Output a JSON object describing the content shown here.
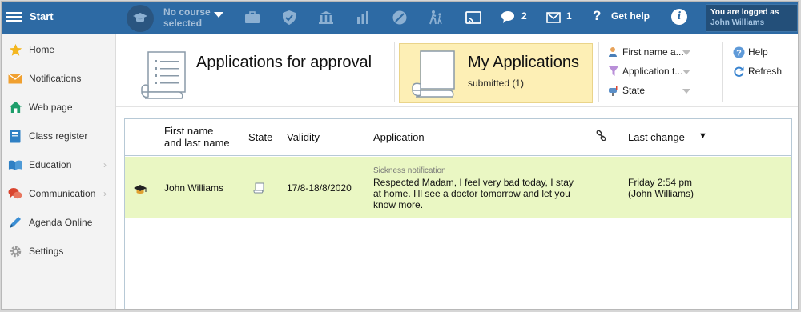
{
  "topbar": {
    "start_label": "Start",
    "course_line1": "No course",
    "course_line2": "selected",
    "messages_count": "2",
    "mail_count": "1",
    "help_label": "Get help",
    "login_line1": "You are logged as",
    "login_user": "John Williams",
    "colors": {
      "bar": "#2d6aa4",
      "login_bg": "#234f79"
    }
  },
  "sidebar": {
    "items": [
      {
        "label": "Home",
        "icon": "star-icon",
        "has_submenu": false
      },
      {
        "label": "Notifications",
        "icon": "envelope-icon",
        "has_submenu": false
      },
      {
        "label": "Web page",
        "icon": "house-icon",
        "has_submenu": false
      },
      {
        "label": "Class register",
        "icon": "register-book-icon",
        "has_submenu": false
      },
      {
        "label": "Education",
        "icon": "open-book-icon",
        "has_submenu": true
      },
      {
        "label": "Communication",
        "icon": "chat-bubbles-icon",
        "has_submenu": true
      },
      {
        "label": "Agenda Online",
        "icon": "pen-icon",
        "has_submenu": false
      },
      {
        "label": "Settings",
        "icon": "gear-icon",
        "has_submenu": false
      }
    ]
  },
  "header": {
    "tile_approval_title": "Applications for approval",
    "tile_my_title": "My Applications",
    "tile_my_sub": "submitted (1)",
    "filters": [
      {
        "label": "First name a...",
        "icon": "person-icon"
      },
      {
        "label": "Application t...",
        "icon": "funnel-icon"
      },
      {
        "label": "State",
        "icon": "mailbox-icon"
      }
    ],
    "help_label": "Help",
    "refresh_label": "Refresh",
    "active_tile_color": "#fdefb5"
  },
  "table": {
    "columns": {
      "name_line1": "First name",
      "name_line2": "and last name",
      "state": "State",
      "validity": "Validity",
      "application": "Application",
      "last_change": "Last change"
    },
    "rows": [
      {
        "name": "John Williams",
        "validity": "17/8-18/8/2020",
        "app_type": "Sickness notification",
        "app_text": "Respected Madam, I feel very bad today, I stay at home. I'll see a doctor tomorrow and let you know more.",
        "last_change_line1": "Friday 2:54 pm",
        "last_change_line2": "(John Williams)",
        "highlight_color": "#eaf7c3"
      }
    ]
  }
}
